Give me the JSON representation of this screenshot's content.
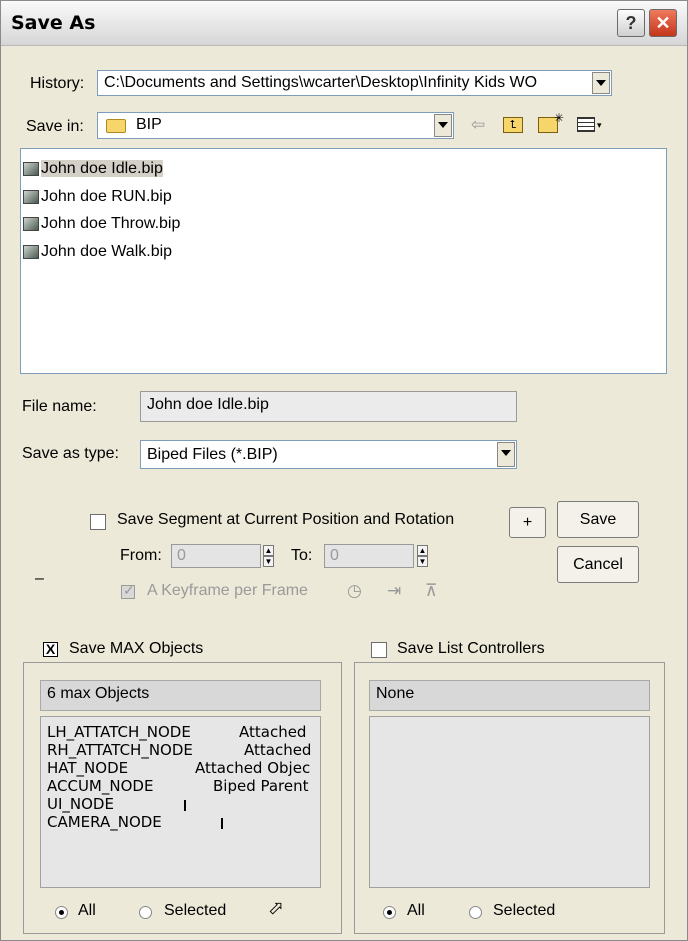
{
  "window": {
    "title": "Save As"
  },
  "titlebar": {
    "help_glyph": "?",
    "close_glyph": "✕"
  },
  "history": {
    "label": "History:",
    "value": "C:\\Documents and Settings\\wcarter\\Desktop\\Infinity Kids WO"
  },
  "save_in": {
    "label": "Save in:",
    "value": "BIP"
  },
  "toolbar_icons": [
    "back-arrow-icon",
    "up-folder-icon",
    "new-folder-icon",
    "view-menu-icon"
  ],
  "files": [
    {
      "name": "John doe Idle.bip",
      "selected": true
    },
    {
      "name": "John doe RUN.bip",
      "selected": false
    },
    {
      "name": "John doe Throw.bip",
      "selected": false
    },
    {
      "name": "John doe Walk.bip",
      "selected": false
    }
  ],
  "file_name": {
    "label": "File name:",
    "value": "John doe Idle.bip"
  },
  "save_type": {
    "label": "Save as type:",
    "value": "Biped Files (*.BIP)"
  },
  "segment": {
    "label": "Save Segment at Current Position and Rotation",
    "checked": false,
    "from_label": "From:",
    "from_value": "0",
    "to_label": "To:",
    "to_value": "0",
    "keyframe_label": "A Keyframe per Frame",
    "keyframe_checked": true
  },
  "buttons": {
    "plus": "+",
    "save": "Save",
    "cancel": "Cancel"
  },
  "dash": "–",
  "max_objects": {
    "label": "Save MAX Objects",
    "checked": true,
    "checkbox_mark": "X",
    "header": "6 max Objects",
    "items": [
      {
        "name": "LH_ATTATCH_NODE",
        "value": "Attached"
      },
      {
        "name": "RH_ATTATCH_NODE",
        "value": "Attached"
      },
      {
        "name": "HAT_NODE",
        "value": "Attached Objec"
      },
      {
        "name": "ACCUM_NODE",
        "value": "Biped Parent"
      },
      {
        "name": "UI_NODE",
        "value": ""
      },
      {
        "name": "CAMERA_NODE",
        "value": ""
      }
    ],
    "radio_all": "All",
    "radio_selected": "Selected",
    "selected_radio": "All"
  },
  "list_controllers": {
    "label": "Save List Controllers",
    "checked": false,
    "header": "None",
    "radio_all": "All",
    "radio_selected": "Selected",
    "selected_radio": "All"
  },
  "colors": {
    "dialog_bg": "#ece9d8",
    "close_button": "#c2361b",
    "list_bg": "#ffffff"
  }
}
